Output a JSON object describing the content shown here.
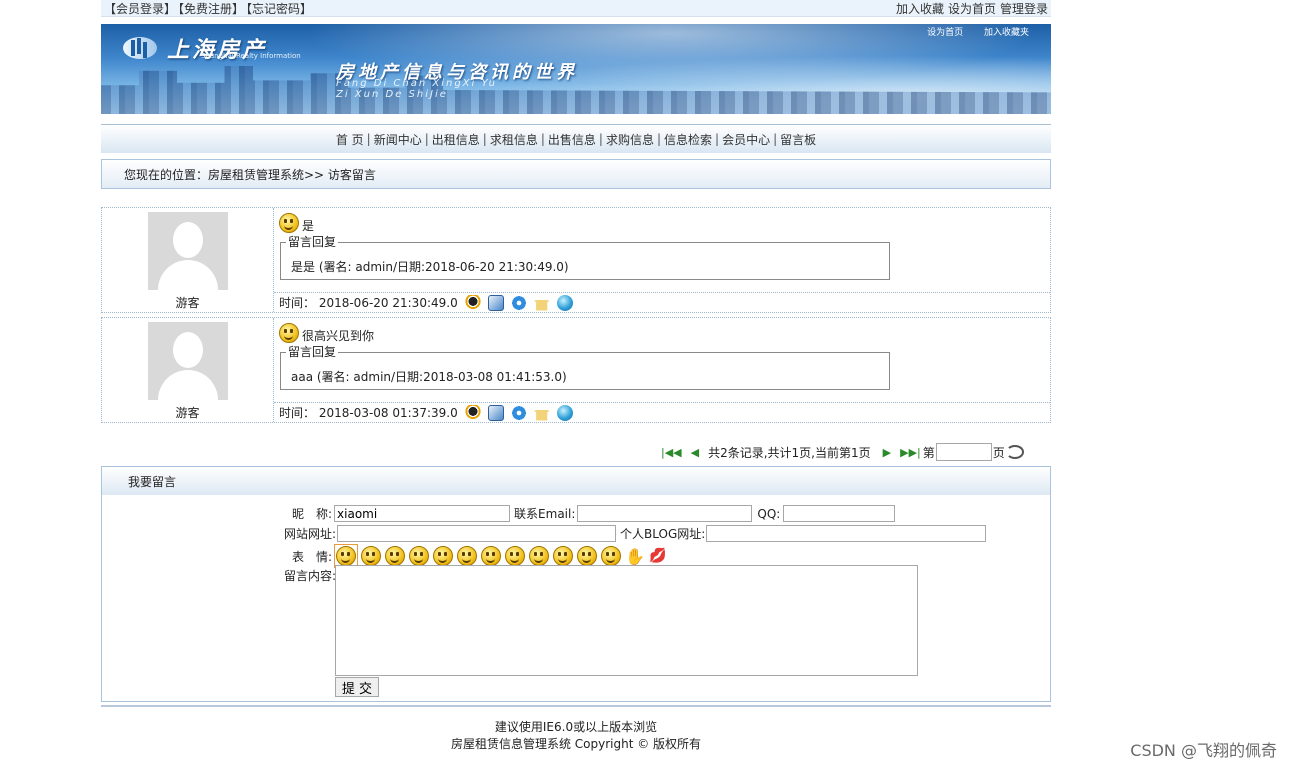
{
  "topbar": {
    "left": [
      "【会员登录】",
      "【免费注册】",
      "【忘记密码】"
    ],
    "right": [
      "加入收藏",
      "设为首页",
      "管理登录"
    ]
  },
  "banner": {
    "logo_text": "上海房产",
    "logo_sub": "Shanghai Realty Information",
    "slogan": "房地产信息与咨讯的世界",
    "pinyin1": "Fang Di Chan XingXi Yu",
    "pinyin2": "Zi Xun De ShiJie",
    "link_home": "设为首页",
    "link_fav": "加入收藏夹"
  },
  "nav": [
    "首 页",
    "新闻中心",
    "出租信息",
    "求租信息",
    "出售信息",
    "求购信息",
    "信息检索",
    "会员中心",
    "留言板"
  ],
  "breadcrumb": "您现在的位置：房屋租赁管理系统>> 访客留言",
  "messages": [
    {
      "name": "游客",
      "content": "是",
      "reply_legend": "留言回复",
      "reply": "是是 (署名: admin/日期:2018-06-20 21:30:49.0)",
      "time": "时间：  2018-06-20 21:30:49.0"
    },
    {
      "name": "游客",
      "content": "很高兴见到你",
      "reply_legend": "留言回复",
      "reply": "aaa (署名: admin/日期:2018-03-08 01:41:53.0)",
      "time": "时间：  2018-03-08 01:37:39.0"
    }
  ],
  "pager": {
    "summary": "共2条记录,共计1页,当前第1页",
    "page_prefix": "第",
    "page_suffix": "页",
    "page_value": ""
  },
  "form": {
    "title": "我要留言",
    "nick_label": "昵　称:",
    "nick_value": "xiaomi",
    "email_label": "联系Email:",
    "email_value": "",
    "qq_label": "QQ:",
    "qq_value": "",
    "site_label": "网站网址:",
    "site_value": "",
    "blog_label": "个人BLOG网址:",
    "blog_value": "",
    "face_label": "表　情:",
    "faces": [
      "smile",
      "sad",
      "laugh",
      "cry",
      "angry",
      "wink",
      "happy",
      "grin",
      "tongue",
      "shy",
      "tired",
      "teeth",
      "hand",
      "lips"
    ],
    "content_label": "留言内容:",
    "content_value": "",
    "submit_label": "提 交"
  },
  "footer": {
    "line1": "建议使用IE6.0或以上版本浏览",
    "line2": "房屋租赁信息管理系统 Copyright © 版权所有"
  },
  "watermark": "CSDN @飞翔的佩奇"
}
